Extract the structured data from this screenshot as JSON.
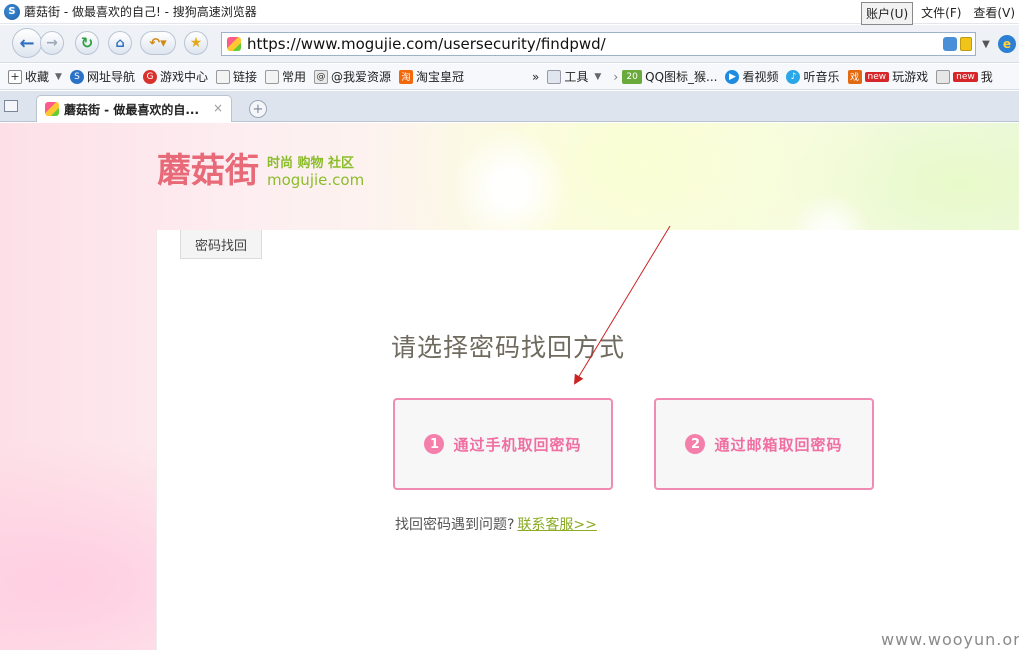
{
  "window": {
    "title": "蘑菇街 - 做最喜欢的自己! - 搜狗高速浏览器",
    "menu": [
      "账户(U)",
      "文件(F)",
      "查看(V)"
    ]
  },
  "navbar": {
    "back_icon": "back-arrow-icon",
    "forward_icon": "forward-arrow-icon",
    "refresh_icon": "refresh-icon",
    "home_icon": "home-icon",
    "undo_icon": "undo-icon",
    "favorite_icon": "star-icon",
    "url": "https://www.mogujie.com/usersecurity/findpwd/"
  },
  "bookmarks": {
    "items": [
      {
        "label": "收藏",
        "icon": "add-bookmark-icon"
      },
      {
        "label": "网址导航",
        "icon": "nav-icon"
      },
      {
        "label": "游戏中心",
        "icon": "game-icon"
      },
      {
        "label": "链接",
        "icon": "folder-icon"
      },
      {
        "label": "常用",
        "icon": "folder-icon"
      },
      {
        "label": "@我爱资源",
        "icon": "web-icon"
      },
      {
        "label": "淘宝皇冠",
        "icon": "taobao-icon"
      }
    ],
    "overflow": "»",
    "tools_label": "工具",
    "right_items": [
      {
        "badge": "20",
        "label": "QQ图标_猴..."
      },
      {
        "label": "看视频"
      },
      {
        "label": "听音乐"
      },
      {
        "badge": "new",
        "label": "玩游戏"
      },
      {
        "badge": "new",
        "label": "我"
      }
    ]
  },
  "tabs": [
    {
      "label": "蘑菇街 - 做最喜欢的自...",
      "close": "×"
    }
  ],
  "new_tab": "+",
  "page": {
    "logo": {
      "cn": "蘑菇街",
      "slogan": "时尚 购物 社区",
      "en": "mogujie.com"
    },
    "panel_tab": "密码找回",
    "heading": "请选择密码找回方式",
    "options": [
      {
        "number": "1",
        "label": "通过手机取回密码"
      },
      {
        "number": "2",
        "label": "通过邮箱取回密码"
      }
    ],
    "help_text": "找回密码遇到问题?",
    "help_link": "联系客服>>"
  },
  "watermark": "www.wooyun.org",
  "colors": {
    "accent_pink": "#f08cb3",
    "logo_red": "#e86a78",
    "logo_green": "#8bbd2a",
    "annotation": "#cc2222"
  }
}
